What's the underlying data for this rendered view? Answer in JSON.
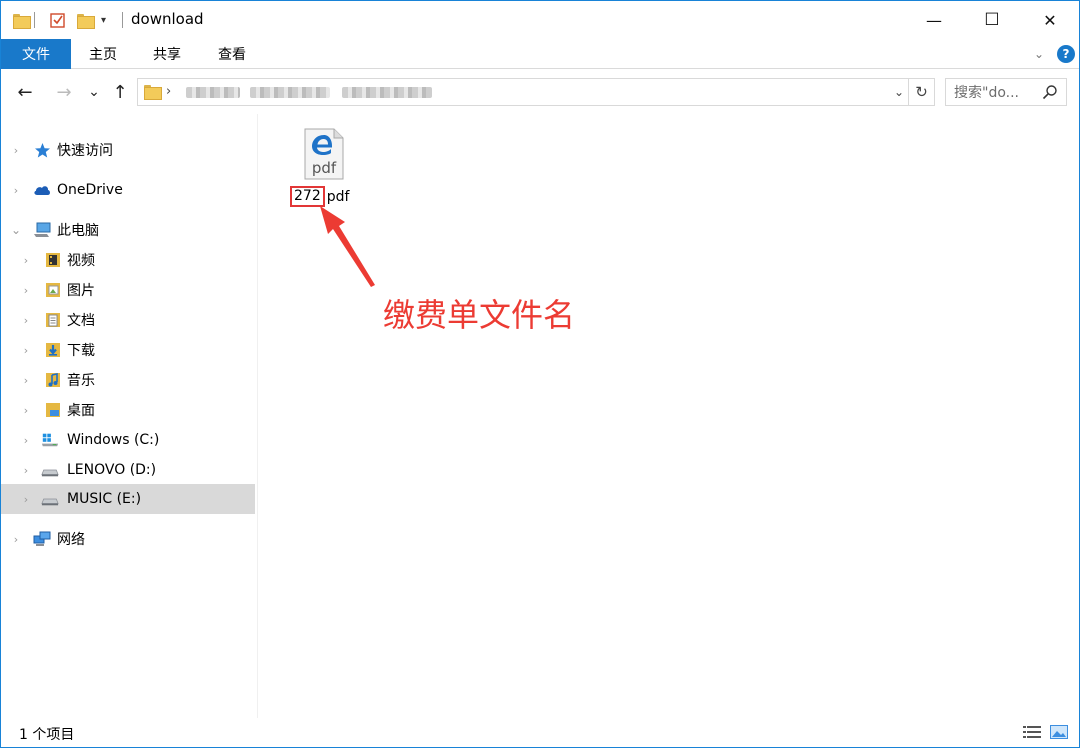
{
  "window": {
    "title": "download",
    "controls": {
      "minimize": "—",
      "maximize": "☐",
      "close": "✕"
    }
  },
  "quick_access_toolbar": {
    "icons": [
      "folder-icon",
      "properties-icon",
      "new-folder-icon",
      "customize-dropdown-icon"
    ]
  },
  "ribbon": {
    "tabs": [
      {
        "label": "文件",
        "active": true
      },
      {
        "label": "主页"
      },
      {
        "label": "共享"
      },
      {
        "label": "查看"
      }
    ],
    "help": "?"
  },
  "address_bar": {
    "back": "←",
    "forward": "→",
    "recent": "⌄",
    "up": "↑",
    "separator": "›",
    "refresh": "↻",
    "search_placeholder": "搜索\"do..."
  },
  "nav_pane": {
    "items": [
      {
        "label": "快速访问",
        "icon": "star-icon",
        "level": 0,
        "expanded": false
      },
      {
        "label": "OneDrive",
        "icon": "cloud-icon",
        "level": 0,
        "expanded": false
      },
      {
        "label": "此电脑",
        "icon": "computer-icon",
        "level": 0,
        "expanded": true
      },
      {
        "label": "视频",
        "icon": "video-folder-icon",
        "level": 1
      },
      {
        "label": "图片",
        "icon": "pictures-folder-icon",
        "level": 1
      },
      {
        "label": "文档",
        "icon": "documents-folder-icon",
        "level": 1
      },
      {
        "label": "下载",
        "icon": "downloads-folder-icon",
        "level": 1
      },
      {
        "label": "音乐",
        "icon": "music-folder-icon",
        "level": 1
      },
      {
        "label": "桌面",
        "icon": "desktop-folder-icon",
        "level": 1
      },
      {
        "label": "Windows (C:)",
        "icon": "windows-drive-icon",
        "level": 1
      },
      {
        "label": "LENOVO (D:)",
        "icon": "drive-icon",
        "level": 1
      },
      {
        "label": "MUSIC (E:)",
        "icon": "drive-icon",
        "level": 1,
        "selected": true
      },
      {
        "label": "网络",
        "icon": "network-icon",
        "level": 0,
        "expanded": false
      }
    ]
  },
  "files": [
    {
      "name_highlighted": "272",
      "name_rest": "pdf",
      "icon": "edge-pdf-icon",
      "icon_text": "pdf"
    }
  ],
  "annotation": {
    "text": "缴费单文件名",
    "color": "#ec3b33"
  },
  "status_bar": {
    "item_count": "1 个项目"
  },
  "colors": {
    "accent": "#1979ca",
    "selection": "#d9d9d9",
    "annotation": "#ec3b33"
  }
}
